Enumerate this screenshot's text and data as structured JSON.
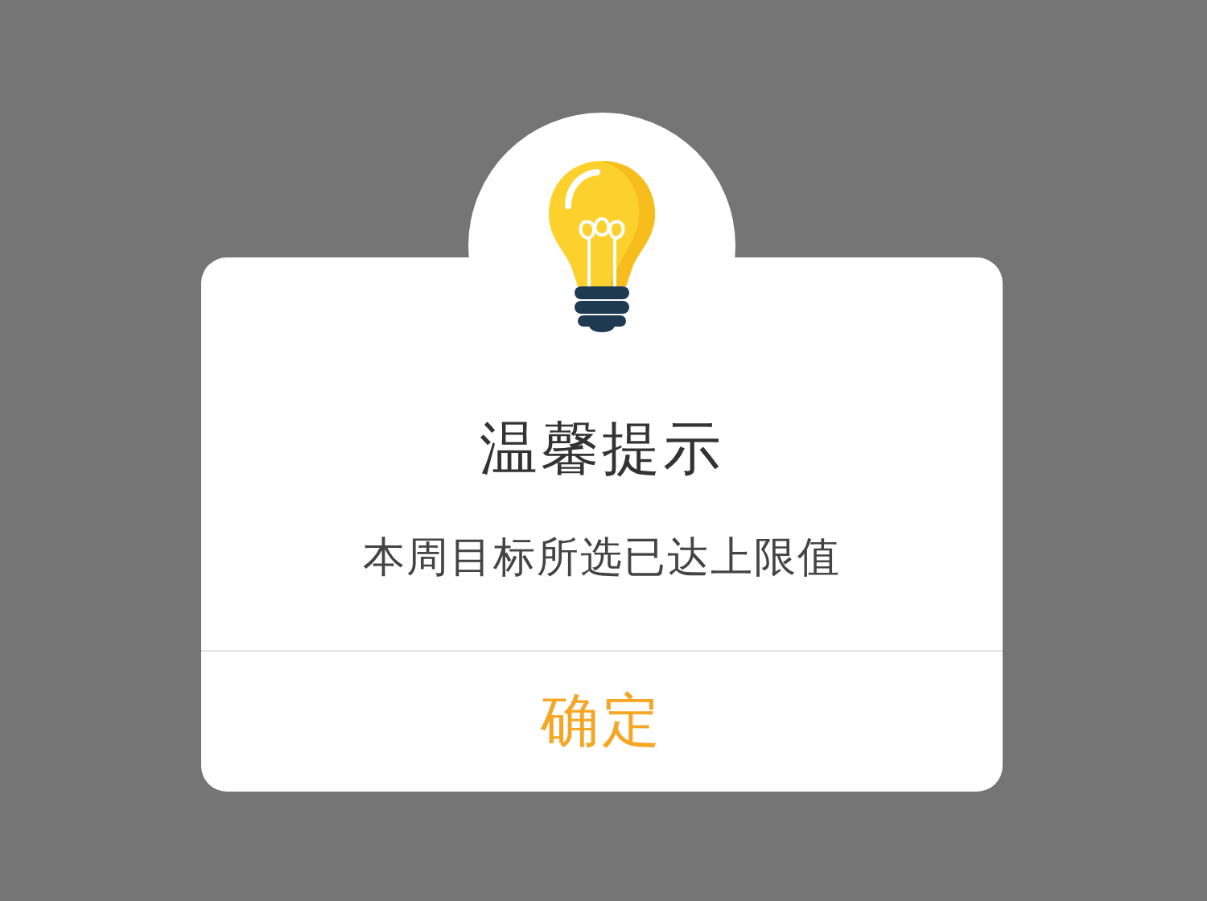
{
  "dialog": {
    "title": "温馨提示",
    "message": "本周目标所选已达上限值",
    "buttons": [
      "确定"
    ]
  }
}
